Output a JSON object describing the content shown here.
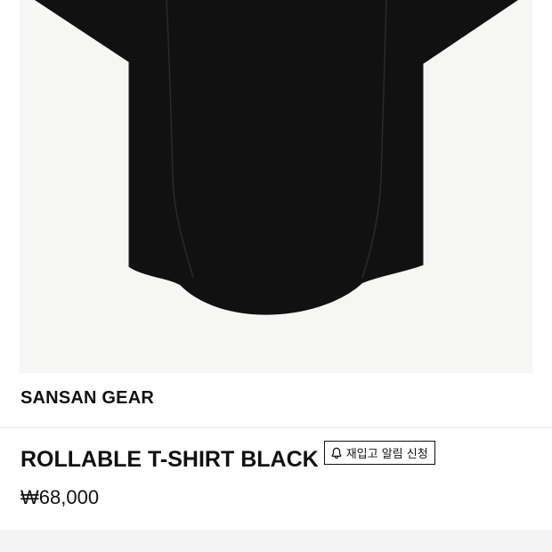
{
  "product": {
    "brand": "SANSAN GEAR",
    "title": "ROLLABLE T-SHIRT BLACK",
    "price": "₩68,000",
    "restock_button_label": "재입고 알림 신청",
    "restock_icon": "bell-icon",
    "image_alt": "ROLLABLE T-SHIRT BLACK",
    "color": "#111111"
  },
  "info": {
    "partial_text": ""
  },
  "colors": {
    "image_background": "#f6f6f4",
    "garment": "#111111",
    "text": "#111111",
    "divider": "#e2e2e2",
    "info_band": "#f4f4f4"
  }
}
